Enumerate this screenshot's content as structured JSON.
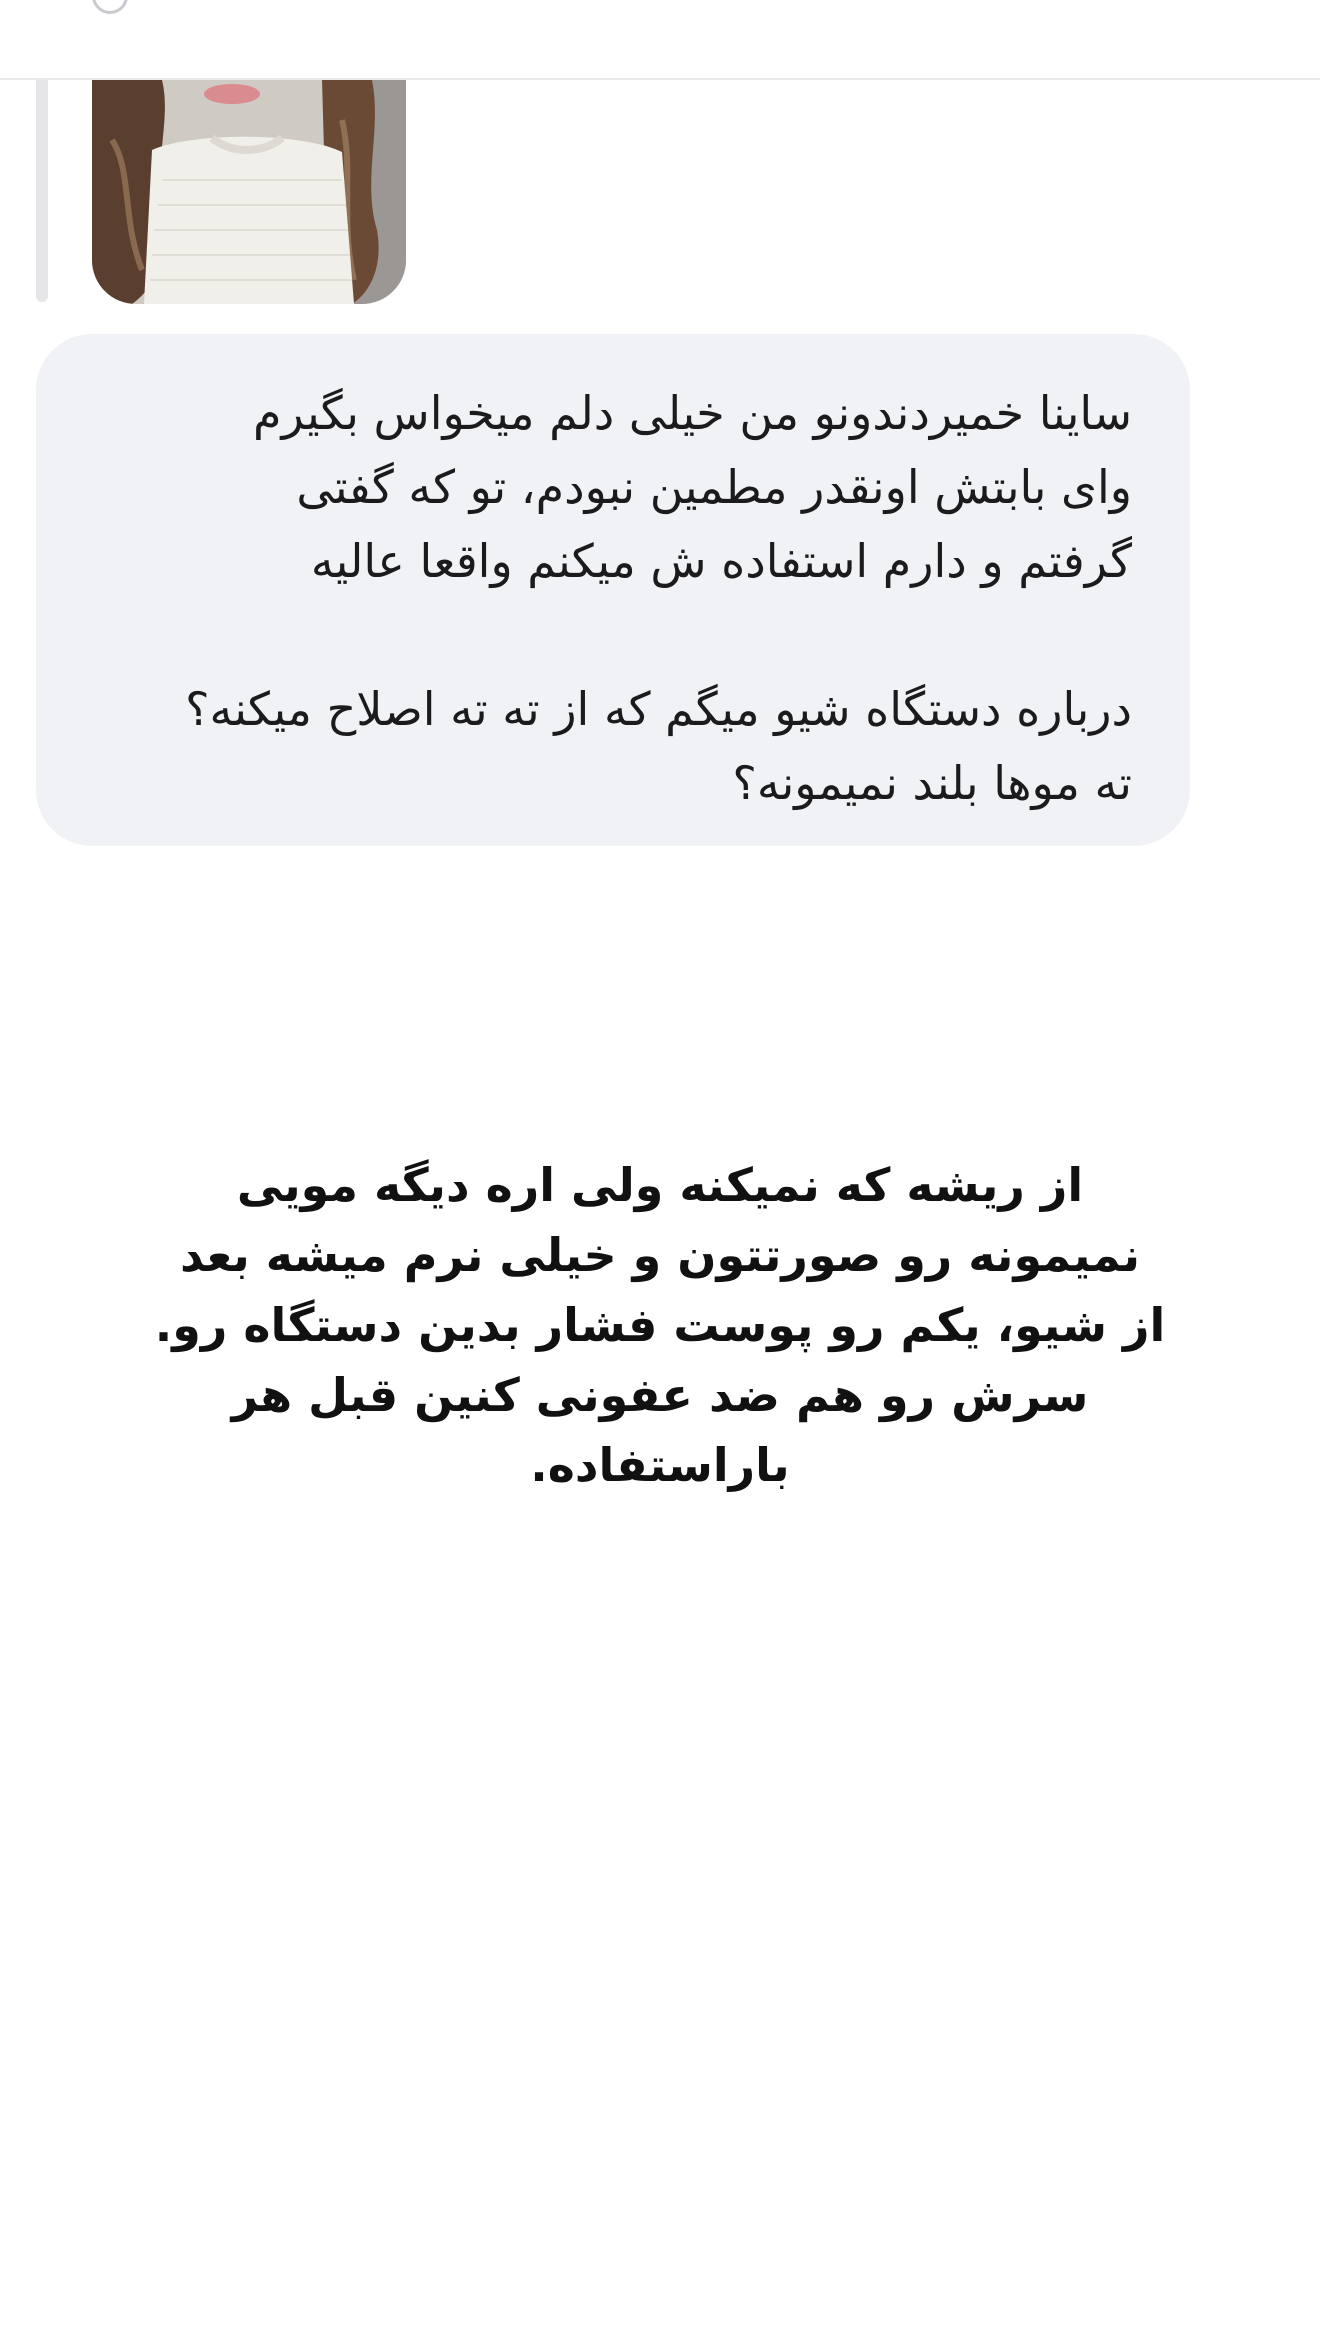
{
  "message": {
    "lines": [
      "ساینا خمیردندونو من خیلی دلم میخواس بگیرم",
      "وای بابتش اونقدر مطمین نبودم، تو که گفتی",
      "گرفتم و دارم استفاده ش میکنم واقعا عالیه",
      "درباره دستگاه شیو میگم که از ته ته اصلاح میکنه؟",
      "ته موها بلند نمیمونه؟"
    ]
  },
  "reply": {
    "lines": [
      "از ریشه که نمیکنه ولی اره دیگه مویی",
      "نمیمونه رو صورتتون و خیلی نرم میشه بعد",
      "از شیو، یکم رو پوست فشار بدین دستگاه رو.",
      "سرش رو هم ضد عفونی کنین قبل هر",
      "باراستفاده."
    ]
  },
  "colors": {
    "bubble_background": "#f1f2f5",
    "text": "#1b1b1d",
    "divider": "#e9e9ec"
  }
}
